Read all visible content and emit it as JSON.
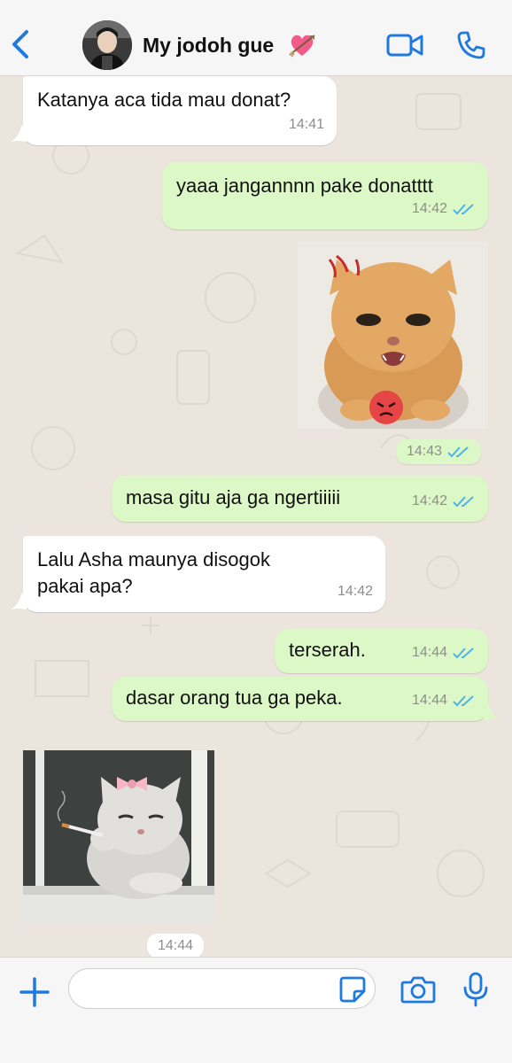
{
  "header": {
    "contact_name": "My jodoh gue",
    "heart_emoji": "💘",
    "back_icon": "chevron-left-icon",
    "video_icon": "video-camera-icon",
    "call_icon": "phone-icon"
  },
  "messages": [
    {
      "direction": "in",
      "text": "Katanya aca tida mau donat?",
      "time": "14:41"
    },
    {
      "direction": "out",
      "text": "yaaa jangannnn pake donatttt",
      "time": "14:42",
      "status": "read"
    },
    {
      "direction": "out",
      "type": "sticker",
      "sticker": "angry-kitten",
      "time": "14:43",
      "status": "read"
    },
    {
      "direction": "out",
      "text": "masa gitu aja ga ngertiiiii",
      "time": "14:42",
      "status": "read"
    },
    {
      "direction": "in",
      "text": "Lalu Asha maunya disogok pakai apa?",
      "time": "14:42"
    },
    {
      "direction": "out",
      "text": "terserah.",
      "time": "14:44",
      "status": "read"
    },
    {
      "direction": "out",
      "text": "dasar orang tua ga peka.",
      "time": "14:44",
      "status": "read"
    },
    {
      "direction": "in",
      "type": "sticker",
      "sticker": "smoking-cat-with-bow",
      "time": "14:44"
    }
  ],
  "composer": {
    "placeholder": "",
    "plus_icon": "plus-icon",
    "sticker_icon": "sticker-icon",
    "camera_icon": "camera-icon",
    "mic_icon": "microphone-icon"
  },
  "colors": {
    "accent": "#1f7ae0",
    "incoming_bubble": "#ffffff",
    "outgoing_bubble": "#dcf8c6",
    "read_ticks": "#4fb3e8",
    "background": "#ece5dd"
  }
}
